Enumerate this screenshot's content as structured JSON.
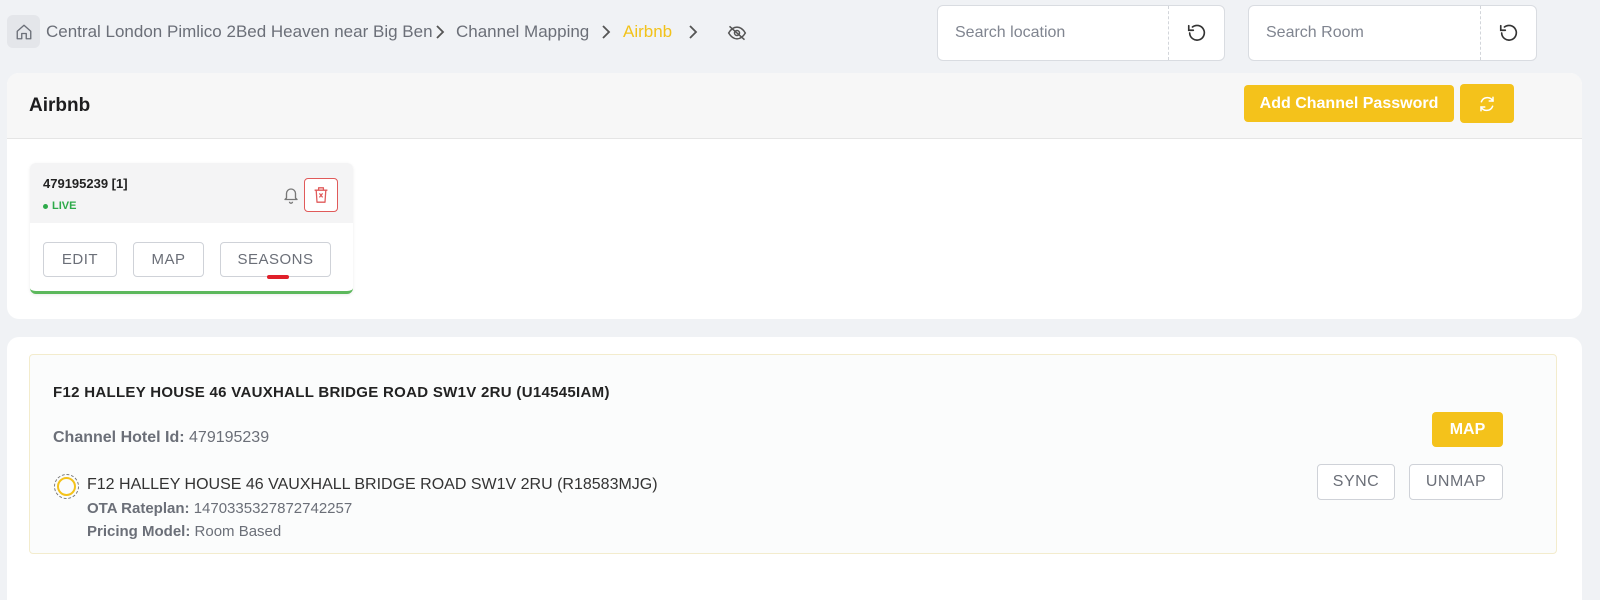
{
  "breadcrumb": {
    "items": [
      "Central London Pimlico 2Bed Heaven near Big Ben",
      "Channel Mapping",
      "Airbnb"
    ]
  },
  "search": {
    "location_placeholder": "Search location",
    "room_placeholder": "Search Room"
  },
  "channel": {
    "title": "Airbnb",
    "add_password_label": "Add Channel Password"
  },
  "card": {
    "id": "479195239 [1]",
    "status": "LIVE",
    "buttons": [
      "EDIT",
      "MAP",
      "SEASONS"
    ]
  },
  "mapping": {
    "room_title": "F12 HALLEY HOUSE 46 VAUXHALL BRIDGE ROAD SW1V 2RU (U14545IAM)",
    "hotel_id_label": "Channel Hotel Id:",
    "hotel_id": "479195239",
    "map_label": "MAP",
    "rateplan": {
      "name": "F12 HALLEY HOUSE 46 VAUXHALL BRIDGE ROAD SW1V 2RU (R18583MJG)",
      "ota_label": "OTA Rateplan:",
      "ota_value": "1470335327872742257",
      "pricing_label": "Pricing Model:",
      "pricing_value": "Room Based"
    },
    "sync_label": "SYNC",
    "unmap_label": "UNMAP"
  },
  "colors": {
    "accent": "#f4c21b",
    "live": "#2eaa4a",
    "danger": "#e05a5a"
  }
}
